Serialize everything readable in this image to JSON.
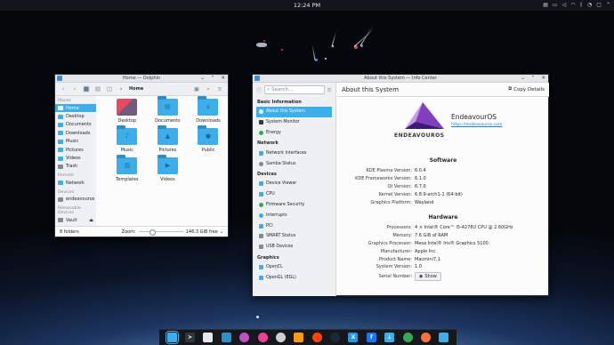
{
  "top_panel": {
    "clock": "12:24 PM",
    "tray_icons": [
      "clipboard-icon",
      "battery-icon",
      "volume-icon",
      "network-icon",
      "bluetooth-icon",
      "notifications-icon",
      "display-icon",
      "expand-tray-icon"
    ]
  },
  "dolphin": {
    "title": "Home — Dolphin",
    "breadcrumb": "Home",
    "sidebar": {
      "places_header": "Places",
      "places": [
        "Home",
        "Desktop",
        "Documents",
        "Downloads",
        "Music",
        "Pictures",
        "Videos",
        "Trash"
      ],
      "remote_header": "Remote",
      "remote": [
        "Network"
      ],
      "devices_header": "Devices",
      "devices": [
        "endeavouros"
      ],
      "removable_header": "Removable Devices",
      "removable": [
        "Vault"
      ]
    },
    "files": [
      {
        "name": "Desktop",
        "icon": "desktop-folder-icon"
      },
      {
        "name": "Documents",
        "icon": "documents-folder-icon"
      },
      {
        "name": "Downloads",
        "icon": "downloads-folder-icon"
      },
      {
        "name": "Music",
        "icon": "music-folder-icon"
      },
      {
        "name": "Pictures",
        "icon": "pictures-folder-icon"
      },
      {
        "name": "Public",
        "icon": "public-folder-icon"
      },
      {
        "name": "Templates",
        "icon": "templates-folder-icon"
      },
      {
        "name": "Videos",
        "icon": "videos-folder-icon"
      }
    ],
    "status": {
      "count": "8 folders",
      "zoom_label": "Zoom:",
      "free": "146.3 GiB free"
    }
  },
  "infocenter": {
    "title": "About this System — Info Center",
    "search_placeholder": "Search...",
    "page_title": "About this System",
    "copy_details": "Copy Details",
    "sidebar": [
      {
        "header": "Basic Information",
        "items": [
          "About this System",
          "System Monitor",
          "Energy"
        ]
      },
      {
        "header": "Network",
        "items": [
          "Network Interfaces",
          "Samba Status"
        ]
      },
      {
        "header": "Devices",
        "items": [
          "Device Viewer",
          "CPU",
          "Firmware Security",
          "Interrupts",
          "PCI",
          "SMART Status",
          "USB Devices"
        ]
      },
      {
        "header": "Graphics",
        "items": [
          "OpenCL",
          "OpenGL (EGL)"
        ]
      }
    ],
    "distro": {
      "name": "EndeavourOS",
      "url": "https://endeavouros.com",
      "logo_text": "ENDEAVOUROS"
    },
    "software_header": "Software",
    "software": [
      {
        "k": "KDE Plasma Version:",
        "v": "6.0.4"
      },
      {
        "k": "KDE Frameworks Version:",
        "v": "6.1.0"
      },
      {
        "k": "Qt Version:",
        "v": "6.7.0"
      },
      {
        "k": "Kernel Version:",
        "v": "6.8.9-arch1-1 (64-bit)"
      },
      {
        "k": "Graphics Platform:",
        "v": "Wayland"
      }
    ],
    "hardware_header": "Hardware",
    "hardware": [
      {
        "k": "Processors:",
        "v": "4 × Intel® Core™ i5-4278U CPU @ 2.60GHz"
      },
      {
        "k": "Memory:",
        "v": "7.6 GiB of RAM"
      },
      {
        "k": "Graphics Processor:",
        "v": "Mesa Intel® Iris® Graphics 5100"
      },
      {
        "k": "Manufacturer:",
        "v": "Apple Inc."
      },
      {
        "k": "Product Name:",
        "v": "Macmini7,1"
      },
      {
        "k": "System Version:",
        "v": "1.0"
      }
    ],
    "serial_label": "Serial Number:",
    "show_button": "Show"
  },
  "taskbar": {
    "apps": [
      {
        "name": "file-manager-icon",
        "color": "#3daee9",
        "glyph": ""
      },
      {
        "name": "terminal-icon",
        "color": "#31363b",
        "glyph": ">"
      },
      {
        "name": "document-viewer-icon",
        "color": "#e8e8e8",
        "glyph": ""
      },
      {
        "name": "text-editor-icon",
        "color": "#2a8fca",
        "glyph": ""
      },
      {
        "name": "color-picker-icon",
        "color": "#c44fc4",
        "glyph": ""
      },
      {
        "name": "media-player-icon",
        "color": "#e84393",
        "glyph": ""
      },
      {
        "name": "settings-icon",
        "color": "#d0d0d0",
        "glyph": ""
      },
      {
        "name": "vlc-icon",
        "color": "#f39c12",
        "glyph": ""
      },
      {
        "name": "reddit-icon",
        "color": "#ff4500",
        "glyph": ""
      },
      {
        "name": "steam-icon",
        "color": "#1b2838",
        "glyph": ""
      },
      {
        "name": "x-icon",
        "color": "#1d9bf0",
        "glyph": "X"
      },
      {
        "name": "facebook-icon",
        "color": "#1877f2",
        "glyph": "f"
      },
      {
        "name": "downloader-icon",
        "color": "#3daee9",
        "glyph": "↓"
      },
      {
        "name": "chrome-icon",
        "color": "#34a853",
        "glyph": ""
      },
      {
        "name": "firefox-icon",
        "color": "#ff7139",
        "glyph": ""
      },
      {
        "name": "info-center-icon",
        "color": "#3daee9",
        "glyph": ""
      }
    ]
  },
  "colors": {
    "accent": "#3daee9",
    "logo_purple": "#7f3fbf",
    "logo_light": "#c89be8"
  }
}
